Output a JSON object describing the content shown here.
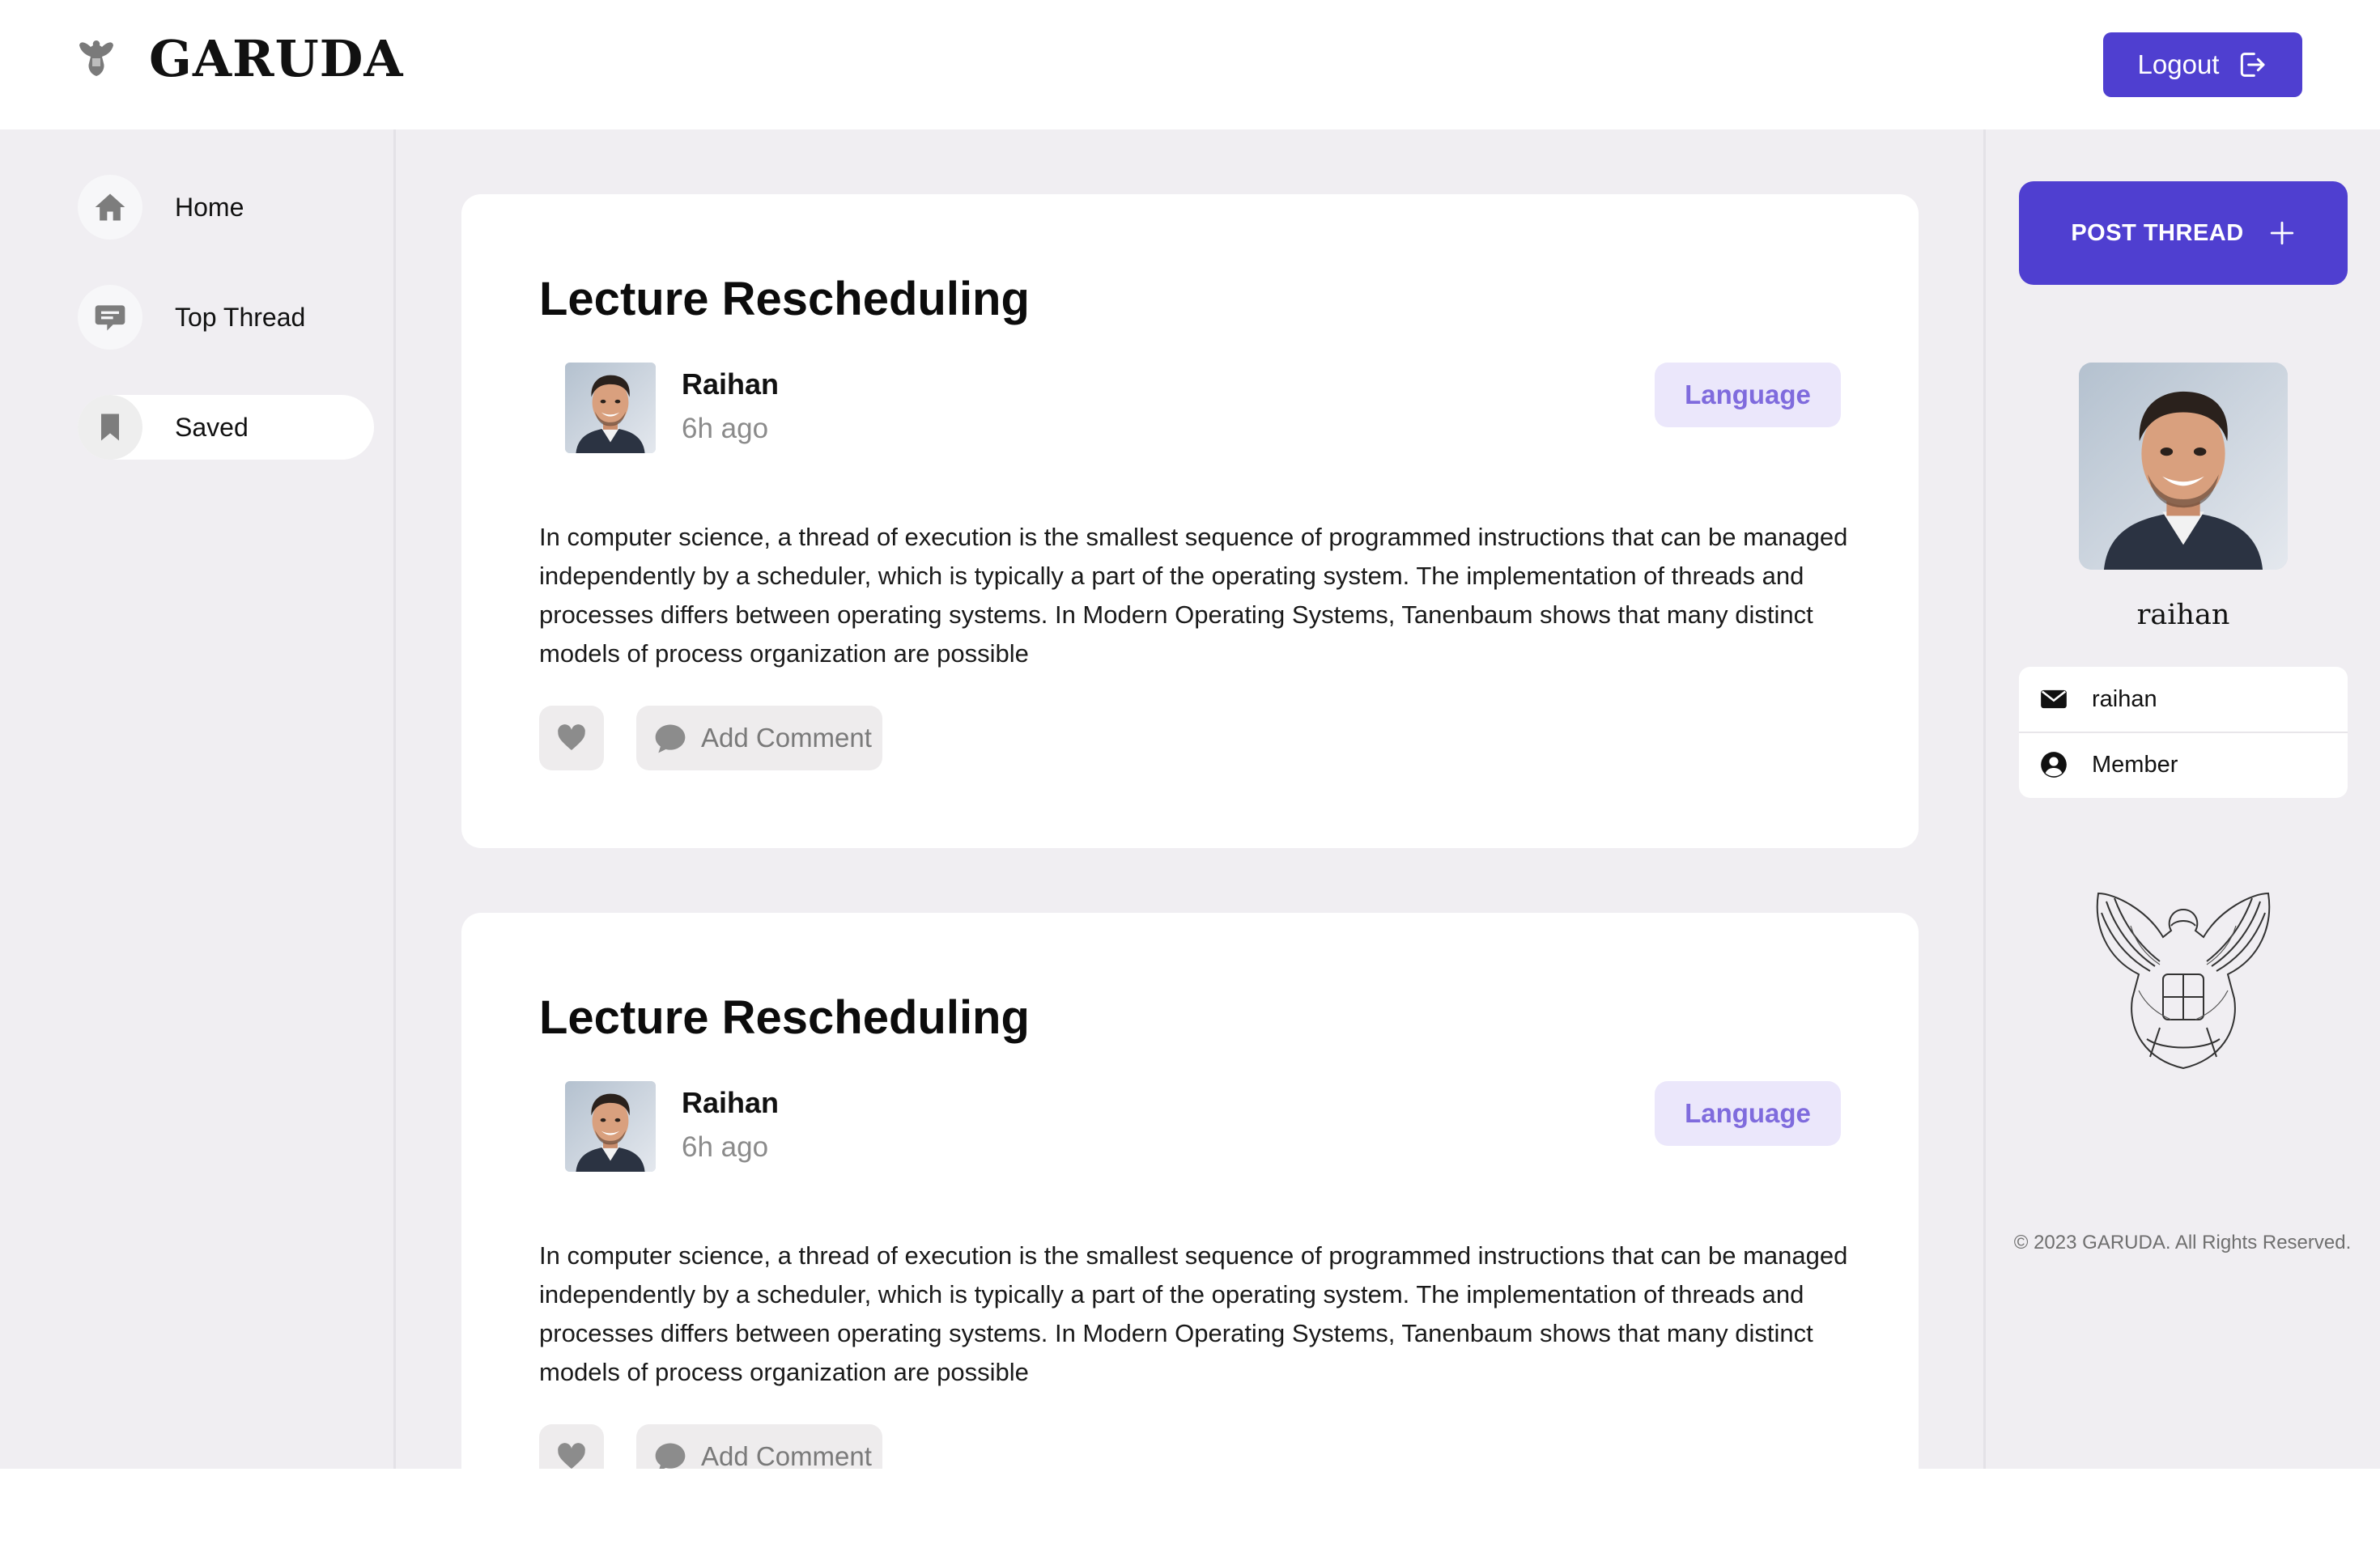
{
  "header": {
    "brand": "GARUDA",
    "logout_label": "Logout"
  },
  "sidebar": {
    "items": [
      {
        "label": "Home",
        "icon": "home-icon"
      },
      {
        "label": "Top Thread",
        "icon": "chat-icon"
      },
      {
        "label": "Saved",
        "icon": "bookmark-icon",
        "active": true
      }
    ]
  },
  "threads": [
    {
      "title": "Lecture Rescheduling",
      "author": "Raihan",
      "time": "6h ago",
      "category": "Language",
      "body": "In computer science, a thread of execution is the smallest sequence of programmed instructions that can be managed independently by a scheduler, which is typically a part of the operating system. The implementation of threads and processes differs between operating systems. In Modern Operating Systems, Tanenbaum shows that many distinct models of process organization are possible",
      "comment_label": "Add Comment"
    },
    {
      "title": "Lecture Rescheduling",
      "author": "Raihan",
      "time": "6h ago",
      "category": "Language",
      "body": "In computer science, a thread of execution is the smallest sequence of programmed instructions that can be managed independently by a scheduler, which is typically a part of the operating system. The implementation of threads and processes differs between operating systems. In Modern Operating Systems, Tanenbaum shows that many distinct models of process organization are possible",
      "comment_label": "Add Comment"
    }
  ],
  "right_panel": {
    "post_thread_label": "POST THREAD",
    "profile_name": "raihan",
    "email": "raihan",
    "role": "Member",
    "footer": "© 2023 GARUDA. All Rights Reserved."
  },
  "colors": {
    "accent": "#4f3fd0",
    "background": "#f0eef2",
    "tag_bg": "#ebe7fb",
    "tag_text": "#7f6bdd"
  }
}
